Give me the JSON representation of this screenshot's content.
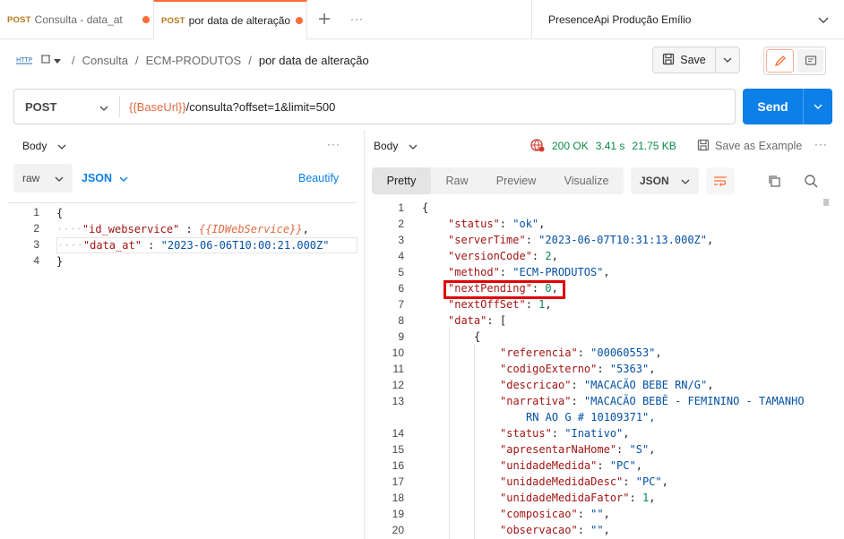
{
  "tabs": [
    {
      "method": "POST",
      "title": "Consulta - data_at",
      "dirty": true
    },
    {
      "method": "POST",
      "title": "por data de alteração",
      "dirty": true
    }
  ],
  "tab_more": "···",
  "environment": "PresenceApi Produção Emílio",
  "breadcrumb": {
    "items": [
      "Consulta",
      "ECM-PRODUTOS"
    ],
    "current": "por data de alteração",
    "separator": "/"
  },
  "save_label": "Save",
  "request": {
    "method": "POST",
    "url_var": "{{BaseUrl}}",
    "url_rest": "/consulta?offset=1&limit=500",
    "send_label": "Send"
  },
  "left": {
    "section": "Body",
    "body_type": "raw",
    "language": "JSON",
    "beautify": "Beautify",
    "more": "···",
    "line_numbers": [
      "1",
      "2",
      "3",
      "4"
    ],
    "lines": {
      "l1": "{",
      "l2_key": "\"id_webservice\"",
      "l2_colon": " : ",
      "l2_val": "{{IDWebService}}",
      "l2_comma": ",",
      "l3_key": "\"data_at\"",
      "l3_colon": " : ",
      "l3_val": "\"2023-06-06T10:00:21.000Z\"",
      "l4": "}"
    }
  },
  "right": {
    "section": "Body",
    "status_code": "200 OK",
    "time": "3.41 s",
    "size": "21.75 KB",
    "save_example": "Save as Example",
    "more": "···",
    "view_tabs": [
      "Pretty",
      "Raw",
      "Preview",
      "Visualize"
    ],
    "active_view": "Pretty",
    "format": "JSON",
    "line_numbers": [
      "1",
      "2",
      "3",
      "4",
      "5",
      "6",
      "7",
      "8",
      "9",
      "10",
      "11",
      "12",
      "13",
      "",
      "14",
      "15",
      "16",
      "17",
      "18",
      "19",
      "20"
    ],
    "code": [
      {
        "t": "{"
      },
      {
        "k": "\"status\"",
        "v": "\"ok\"",
        "vt": "s",
        "c": ","
      },
      {
        "k": "\"serverTime\"",
        "v": "\"2023-06-07T10:31:13.000Z\"",
        "vt": "s",
        "c": ","
      },
      {
        "k": "\"versionCode\"",
        "v": "2",
        "vt": "n",
        "c": ","
      },
      {
        "k": "\"method\"",
        "v": "\"ECM-PRODUTOS\"",
        "vt": "s",
        "c": ","
      },
      {
        "k": "\"nextPending\"",
        "v": "0",
        "vt": "n",
        "c": ","
      },
      {
        "k": "\"nextOffSet\"",
        "v": "1",
        "vt": "n",
        "c": ","
      },
      {
        "k": "\"data\"",
        "v": "[",
        "vt": "p",
        "c": ""
      },
      {
        "t": "{"
      },
      {
        "k": "\"referencia\"",
        "v": "\"00060553\"",
        "vt": "s",
        "c": ","
      },
      {
        "k": "\"codigoExterno\"",
        "v": "\"5363\"",
        "vt": "s",
        "c": ","
      },
      {
        "k": "\"descricao\"",
        "v": "\"MACACÃO BEBE RN/G\"",
        "vt": "s",
        "c": ","
      },
      {
        "k": "\"narrativa\"",
        "v": "\"MACACÃO BEBÊ - FEMININO - TAMANHO",
        "vt": "s",
        "c": ""
      },
      {
        "t": "RN AO G # 10109371\",",
        "vt": "s"
      },
      {
        "k": "\"status\"",
        "v": "\"Inativo\"",
        "vt": "s",
        "c": ","
      },
      {
        "k": "\"apresentarNaHome\"",
        "v": "\"S\"",
        "vt": "s",
        "c": ","
      },
      {
        "k": "\"unidadeMedida\"",
        "v": "\"PC\"",
        "vt": "s",
        "c": ","
      },
      {
        "k": "\"unidadeMedidaDesc\"",
        "v": "\"PC\"",
        "vt": "s",
        "c": ","
      },
      {
        "k": "\"unidadeMedidaFator\"",
        "v": "1",
        "vt": "n",
        "c": ","
      },
      {
        "k": "\"composicao\"",
        "v": "\"\"",
        "vt": "s",
        "c": ","
      },
      {
        "k": "\"observacao\"",
        "v": "\"\"",
        "vt": "s",
        "c": ","
      }
    ]
  },
  "colors": {
    "accent": "#ff6c37",
    "send": "#0d7fe8",
    "ok": "#0b8a47",
    "highlight": "#e00000"
  }
}
